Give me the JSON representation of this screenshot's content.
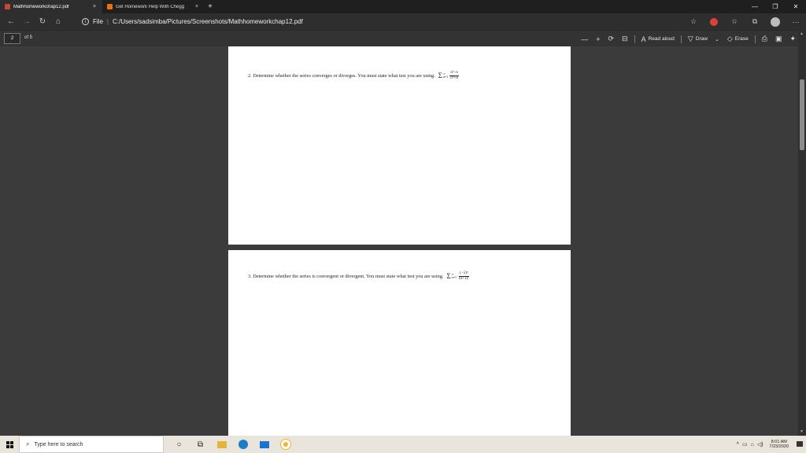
{
  "browser": {
    "tabs": [
      {
        "title": "Mathhomeworkchap12.pdf",
        "close": "×",
        "active": true,
        "icon": "pdf-icon",
        "icon_color": "#c74634"
      },
      {
        "title": "Get Homework Help With Chegg",
        "close": "×",
        "active": false,
        "icon": "chegg-icon",
        "icon_color": "#eb7100"
      }
    ],
    "new_tab": "+",
    "window_controls": {
      "minimize": "—",
      "maximize": "❐",
      "close": "✕"
    },
    "nav": {
      "back": "←",
      "forward": "→",
      "refresh": "↻",
      "home": "⌂"
    },
    "address": {
      "scheme_label": "File",
      "separator": "|",
      "path": "C:/Users/sadsimba/Pictures/Screenshots/Mathhomeworkchap12.pdf"
    },
    "right_icons": {
      "favorite": "☆",
      "collections": "☆",
      "more": "···"
    }
  },
  "pdf_toolbar": {
    "page_current": "2",
    "page_of": "of 5",
    "zoom_out": "—",
    "zoom_in": "+",
    "read_aloud": "Read aloud",
    "draw": "Draw",
    "erase": "Erase"
  },
  "document": {
    "problem2": {
      "text": "2.  Determine whether the series converges or diverges. You must state what test you are using.",
      "sigma_upper": "∞",
      "sigma_lower": "n=1",
      "numerator": "n²−n",
      "denominator": "n⁴+8"
    },
    "problem3": {
      "text": "3.  Determine whether the series is convergent or divergent. You must state what test you are using.",
      "sigma_upper": "∞",
      "sigma_lower": "n=1",
      "numerator": "(−5)ⁿ",
      "denominator": "(n+1)!"
    }
  },
  "taskbar": {
    "search_placeholder": "Type here to search",
    "time": "8:01 AM",
    "date": "7/23/2020",
    "tray_chevron": "^"
  },
  "colors": {
    "accent_blue": "#1e7cc8",
    "taskbar_bg": "#e9e4dc",
    "page_bg": "#ffffff",
    "viewer_bg": "#3b3b3b"
  }
}
